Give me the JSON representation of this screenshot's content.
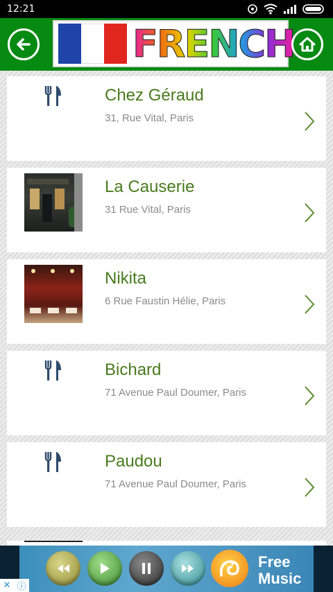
{
  "status_bar": {
    "time": "12:21",
    "icons": [
      "alarm-icon",
      "wifi-icon",
      "signal-icon",
      "battery-icon"
    ]
  },
  "header": {
    "title": "FRENCH",
    "back_icon": "arrow-left-icon",
    "home_icon": "home-icon",
    "bar_color": "#078a12"
  },
  "restaurants": [
    {
      "name": "Chez Géraud",
      "address": "31, Rue Vital, Paris",
      "image": "fork-knife-icon"
    },
    {
      "name": "La Causerie",
      "address": "31 Rue Vital, Paris",
      "image": "photo"
    },
    {
      "name": "Nikita",
      "address": "6 Rue Faustin Hélie, Paris",
      "image": "photo"
    },
    {
      "name": "Bichard",
      "address": "71 Avenue Paul Doumer, Paris",
      "image": "fork-knife-icon"
    },
    {
      "name": "Paudou",
      "address": "71 Avenue Paul Doumer, Paris",
      "image": "fork-knife-icon"
    }
  ],
  "ad": {
    "text_line1": "Free",
    "text_line2": "Music",
    "close_icon": "close-icon",
    "info_icon": "info-icon"
  }
}
